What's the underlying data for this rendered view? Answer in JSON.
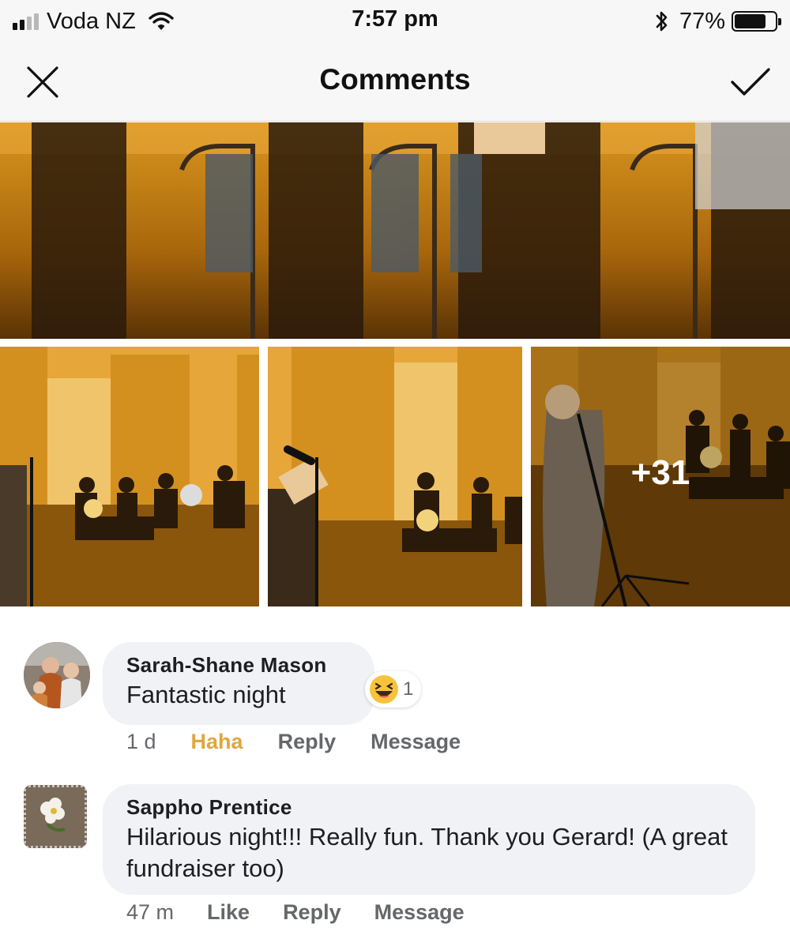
{
  "status_bar": {
    "carrier": "Voda NZ",
    "time": "7:57 pm",
    "battery_percent": "77%",
    "battery_level": 0.77,
    "signal_bars_active": 2,
    "signal_bars_total": 4
  },
  "header": {
    "title": "Comments",
    "close_icon": "close-icon",
    "done_icon": "checkmark-icon"
  },
  "photos": {
    "more_count": "+31"
  },
  "comments": [
    {
      "author": "Sarah-Shane Mason",
      "text": "Fantastic night",
      "time": "1 d",
      "reaction_label": "Haha",
      "reply_label": "Reply",
      "message_label": "Message",
      "reaction_icon": "haha-emoji-icon",
      "reaction_count": "1"
    },
    {
      "author": "Sappho Prentice",
      "text": "Hilarious night!!! Really fun. Thank you Gerard! (A great fundraiser too)",
      "time": "47 m",
      "like_label": "Like",
      "reply_label": "Reply",
      "message_label": "Message"
    }
  ],
  "colors": {
    "accent_haha": "#e1a63b",
    "bubble_bg": "#f0f2f5",
    "secondary_text": "#65676b"
  }
}
